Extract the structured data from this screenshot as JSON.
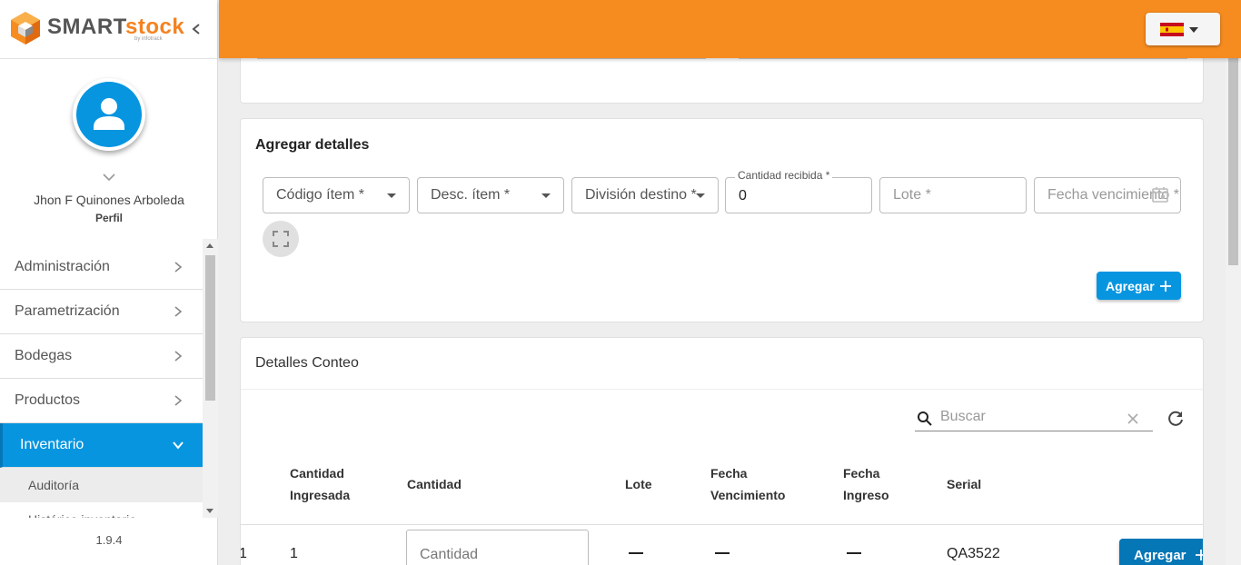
{
  "brand": {
    "name_part1": "SMART",
    "name_part2": "stock",
    "sub": "by infotrack"
  },
  "user": {
    "name": "Jhon F Quinones Arboleda",
    "profile_link": "Perfil"
  },
  "menu": {
    "items": [
      {
        "label": "Administración"
      },
      {
        "label": "Parametrización"
      },
      {
        "label": "Bodegas"
      },
      {
        "label": "Productos"
      },
      {
        "label": "Inventario"
      }
    ],
    "submenu": [
      {
        "label": "Auditoría"
      },
      {
        "label": "Histórico inventario"
      }
    ]
  },
  "version": "1.9.4",
  "header": {
    "language": "es"
  },
  "add_details": {
    "title": "Agregar detalles",
    "fields": {
      "codigo": "Código ítem *",
      "desc": "Desc. ítem *",
      "division": "División destino *",
      "cantidad_label": "Cantidad recibida *",
      "cantidad_value": "0",
      "lote": "Lote *",
      "fecha": "Fecha vencimiento *"
    },
    "add_button": "Agregar"
  },
  "details": {
    "title": "Detalles Conteo",
    "search_placeholder": "Buscar",
    "columns": {
      "cantidad_ingresada_1": "Cantidad",
      "cantidad_ingresada_2": "Ingresada",
      "cantidad": "Cantidad",
      "lote": "Lote",
      "fecha_venc_1": "Fecha",
      "fecha_venc_2": "Vencimiento",
      "fecha_ing_1": "Fecha",
      "fecha_ing_2": "Ingreso",
      "serial": "Serial"
    },
    "row": {
      "index": "1",
      "cantidad_ingresada": "1",
      "cantidad_placeholder": "Cantidad",
      "serial": "QA3522",
      "action": "Agregar"
    }
  },
  "colors": {
    "primary": "#0795e0",
    "header": "#f68b1f"
  }
}
